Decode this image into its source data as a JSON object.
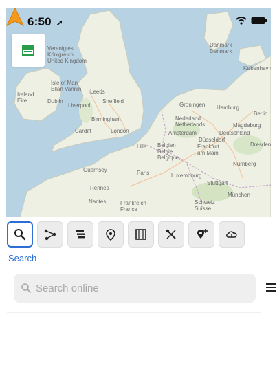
{
  "status_bar": {
    "time": "6:50"
  },
  "map": {
    "labels": {
      "ireland": "Ireland\nÉire",
      "uk": "Verenigtes\nKönigreich\nUnited Kingdom",
      "isle_of_man": "Isle of Man\nEllan Vannin",
      "dublin": "Dublin",
      "liverpool": "Liverpool",
      "leeds": "Leeds",
      "sheffield": "Sheffield",
      "birmingham": "Birmingham",
      "cardiff": "Cardiff",
      "london": "London",
      "denmark": "Danmark\nDenmark",
      "copenhagen": "København",
      "hamburg": "Hamburg",
      "groningen": "Groningen",
      "nederland": "Nederland\nNetherlands",
      "amsterdam": "Amsterdam",
      "dusseldorf": "Düsseldorf",
      "deutschland": "Deutschland",
      "magdeburg": "Magdeburg",
      "berlin": "Berlin",
      "belgium": "Belgien\nBelgie\nBelgique",
      "lille": "Lille",
      "frankfurt": "Frankfurt\nam Main",
      "nurnberg": "Nürnberg",
      "luxembourg": "Luxembourg",
      "paris": "Paris",
      "stuttgart": "Stuttgart",
      "munchen": "München",
      "rennes": "Rennes",
      "nantes": "Nantes",
      "france": "Frankreich\nFrance",
      "schweiz": "Schweiz\nSuisse",
      "guernsey": "Guernsey",
      "dresden": "Dresden"
    }
  },
  "toolbar": {
    "tools": [
      {
        "icon": "search-icon",
        "active": true
      },
      {
        "icon": "route-icon",
        "active": false
      },
      {
        "icon": "list-icon",
        "active": false
      },
      {
        "icon": "location-pin-icon",
        "active": false
      },
      {
        "icon": "map-book-icon",
        "active": false
      },
      {
        "icon": "tools-icon",
        "active": false
      },
      {
        "icon": "pin-add-icon",
        "active": false
      },
      {
        "icon": "cloud-icon",
        "active": false
      }
    ],
    "active_caption": "Search"
  },
  "search": {
    "placeholder": "Search online"
  },
  "colors": {
    "accent": "#2b6fd6",
    "nav_arrow": "#f39a1e"
  }
}
